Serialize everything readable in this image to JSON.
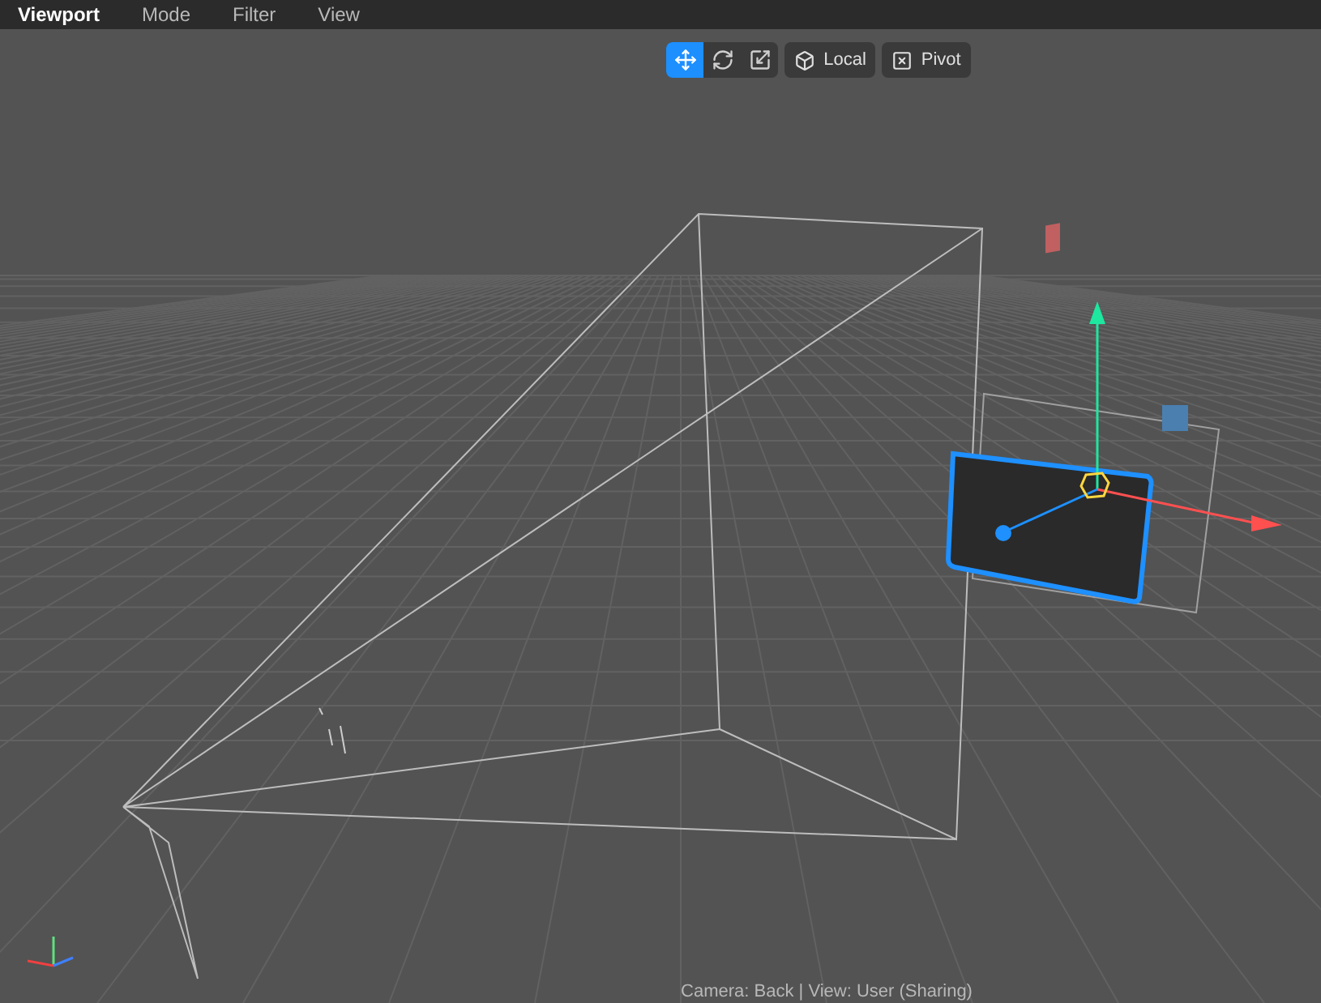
{
  "menu": [
    {
      "label": "Viewport",
      "selected": true
    },
    {
      "label": "Mode",
      "selected": false
    },
    {
      "label": "Filter",
      "selected": false
    },
    {
      "label": "View",
      "selected": false
    }
  ],
  "toolbar": {
    "tools": [
      {
        "kind": "move",
        "selected": true
      },
      {
        "kind": "rotate",
        "selected": false
      },
      {
        "kind": "scale",
        "selected": false
      }
    ],
    "space": {
      "label": "Local"
    },
    "pivot": {
      "label": "Pivot"
    }
  },
  "status": "Camera: Back | View: User (Sharing)"
}
